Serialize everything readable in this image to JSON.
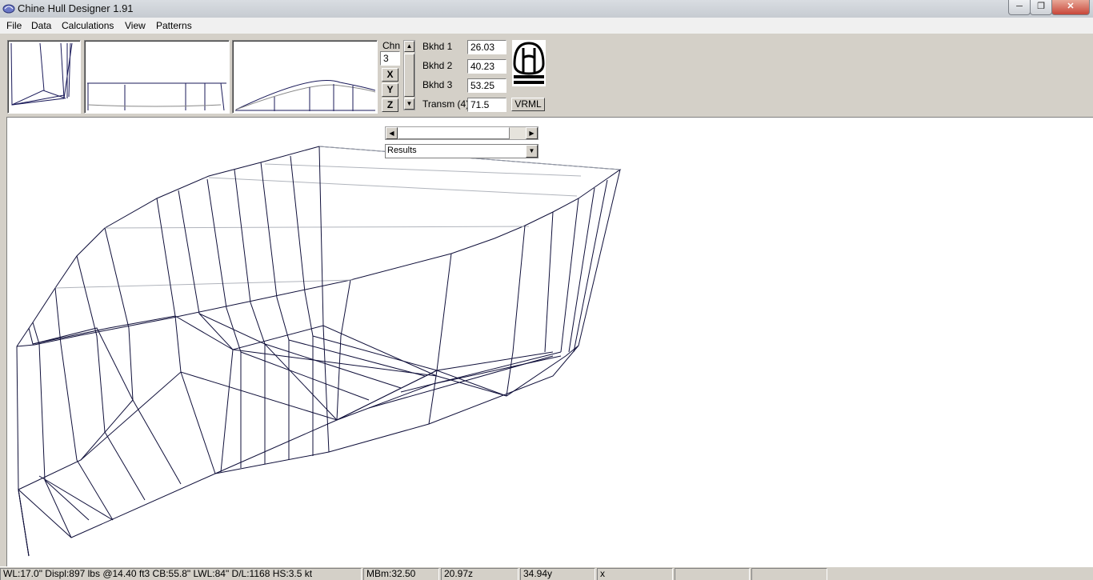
{
  "window": {
    "title": "Chine Hull Designer 1.91"
  },
  "menu": [
    "File",
    "Data",
    "Calculations",
    "View",
    "Patterns"
  ],
  "chine": {
    "label": "Chn",
    "value": "3"
  },
  "axis_buttons": [
    "X",
    "Y",
    "Z"
  ],
  "bulkheads": [
    {
      "label": "Bkhd 1",
      "value": "26.03"
    },
    {
      "label": "Bkhd 2",
      "value": "40.23"
    },
    {
      "label": "Bkhd 3",
      "value": "53.25"
    },
    {
      "label": "Transm (4)",
      "value": "71.5"
    }
  ],
  "vrml_label": "VRML",
  "results_dropdown": {
    "selected": "Results"
  },
  "status": [
    "WL:17.0\"  Displ:897 lbs @14.40 ft3  CB:55.8\"  LWL:84\"  D/L:1168  HS:3.5 kt",
    "MBm:32.50",
    "20.97z",
    "34.94y",
    "x",
    "",
    ""
  ],
  "icons": {
    "app": "hull-app-icon",
    "minimize": "minimize-icon",
    "maximize": "maximize-icon",
    "close": "close-icon",
    "logo": "designer-logo"
  }
}
